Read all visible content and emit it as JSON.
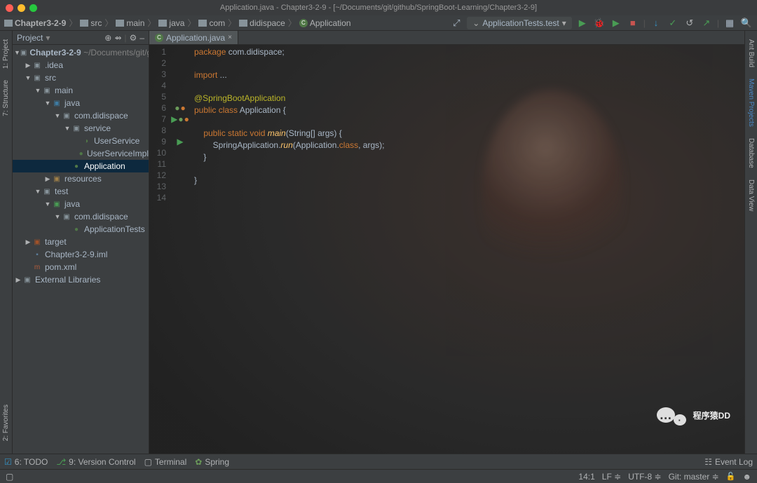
{
  "title": "Application.java - Chapter3-2-9 - [~/Documents/git/github/SpringBoot-Learning/Chapter3-2-9]",
  "breadcrumbs": [
    "Chapter3-2-9",
    "src",
    "main",
    "java",
    "com",
    "didispace",
    "Application"
  ],
  "runConfig": "ApplicationTests.test",
  "leftTabs": {
    "project": "1: Project",
    "structure": "7: Structure",
    "favorites": "2: Favorites"
  },
  "rightTabs": {
    "ant": "Ant Build",
    "maven": "Maven Projects",
    "database": "Database",
    "dataview": "Data View"
  },
  "projectHeader": "Project",
  "tree": {
    "root": {
      "name": "Chapter3-2-9",
      "hint": "~/Documents/git/githu"
    },
    "idea": ".idea",
    "src": "src",
    "main": "main",
    "java": "java",
    "pkg": "com.didispace",
    "service": "service",
    "userService": "UserService",
    "userServiceImpl": "UserServiceImpl",
    "application": "Application",
    "resources": "resources",
    "test": "test",
    "test_java": "java",
    "test_pkg": "com.didispace",
    "appTests": "ApplicationTests",
    "target": "target",
    "iml": "Chapter3-2-9.iml",
    "pom": "pom.xml",
    "extlibs": "External Libraries"
  },
  "tabName": "Application.java",
  "lineNumbers": [
    "1",
    "2",
    "3",
    "4",
    "5",
    "6",
    "7",
    "8",
    "9",
    "10",
    "11",
    "12",
    "13",
    "14"
  ],
  "code": {
    "l1_kw": "package",
    "l1_rest": " com.didispace;",
    "l3_kw": "import",
    "l3_rest": " ...",
    "l5_ann": "@SpringBootApplication",
    "l6_kw": "public class ",
    "l6_cls": "Application",
    "l6_rest": " {",
    "l8_kw": "    public static void ",
    "l8_fn": "main",
    "l8_rest": "(String[] args) {",
    "l9_a": "        SpringApplication.",
    "l9_b": "run",
    "l9_c": "(Application.",
    "l9_d": "class",
    "l9_e": ", args);",
    "l10": "    }",
    "l12": "}"
  },
  "bottom": {
    "todo": "6: TODO",
    "vc": "9: Version Control",
    "terminal": "Terminal",
    "spring": "Spring",
    "eventlog": "Event Log"
  },
  "status": {
    "pos": "14:1",
    "sep": "LF",
    "enc": "UTF-8",
    "git": "Git: master"
  },
  "watermark": "程序猿DD"
}
